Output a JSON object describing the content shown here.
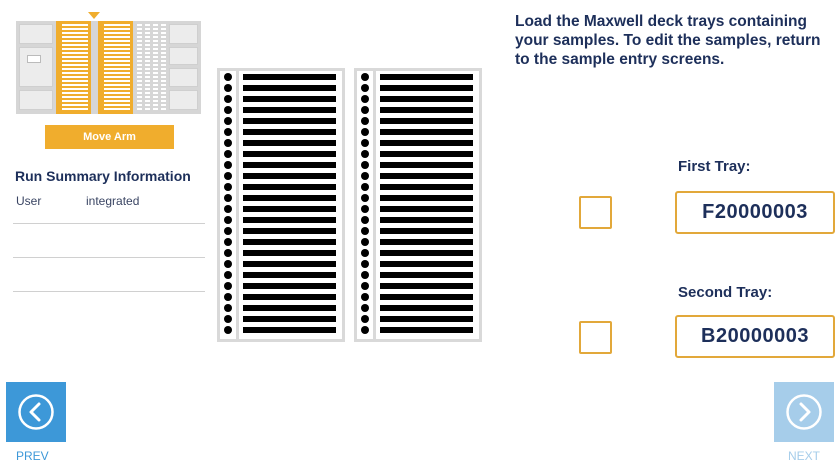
{
  "deck": {
    "move_arm_label": "Move Arm"
  },
  "summary": {
    "title": "Run Summary Information",
    "rows": [
      {
        "key": "User",
        "value": "integrated"
      },
      {
        "key": "",
        "value": ""
      },
      {
        "key": "",
        "value": ""
      }
    ]
  },
  "instructions": "Load the Maxwell deck trays containing your samples. To edit the samples, return to the sample entry screens.",
  "trays": {
    "first": {
      "label": "First Tray:",
      "id": "F20000003",
      "checked": false
    },
    "second": {
      "label": "Second Tray:",
      "id": "B20000003",
      "checked": false
    }
  },
  "nav": {
    "prev_label": "PREV",
    "next_label": "NEXT",
    "prev_icon": "chevron-left-circle-icon",
    "next_icon": "chevron-right-circle-icon"
  },
  "colors": {
    "accent_orange": "#f0ad2d",
    "nav_blue": "#3d98d8",
    "nav_blue_disabled": "#a6cdea",
    "text_navy": "#1d2f5a"
  }
}
